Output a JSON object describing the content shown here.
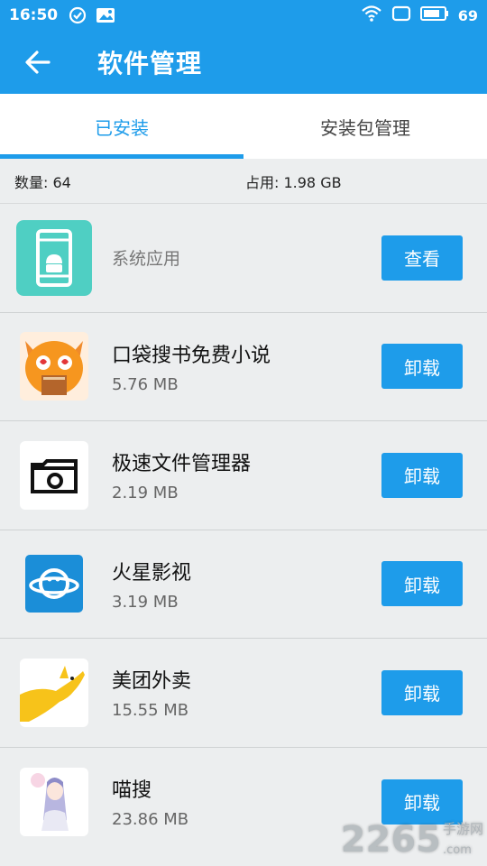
{
  "status_bar": {
    "time": "16:50",
    "battery": "69"
  },
  "app_bar": {
    "title": "软件管理"
  },
  "tabs": [
    {
      "label": "已安装",
      "active": true
    },
    {
      "label": "安装包管理",
      "active": false
    }
  ],
  "summary": {
    "count": "数量: 64",
    "usage": "占用: 1.98 GB"
  },
  "system_apps": {
    "label": "系统应用",
    "button": "查看"
  },
  "apps": [
    {
      "name": "口袋搜书免费小说",
      "size": "5.76 MB",
      "button": "卸载",
      "icon": "cat-book-icon"
    },
    {
      "name": "极速文件管理器",
      "size": "2.19 MB",
      "button": "卸载",
      "icon": "folder-camera-icon"
    },
    {
      "name": "火星影视",
      "size": "3.19 MB",
      "button": "卸载",
      "icon": "planet-icon"
    },
    {
      "name": "美团外卖",
      "size": "15.55 MB",
      "button": "卸载",
      "icon": "kangaroo-icon"
    },
    {
      "name": "喵搜",
      "size": "23.86 MB",
      "button": "卸载",
      "icon": "anime-girl-icon"
    }
  ],
  "watermark": {
    "number": "2265",
    "suffix": ".com",
    "site": "手游网"
  },
  "colors": {
    "primary": "#1e9cea",
    "background": "#eceeef"
  }
}
